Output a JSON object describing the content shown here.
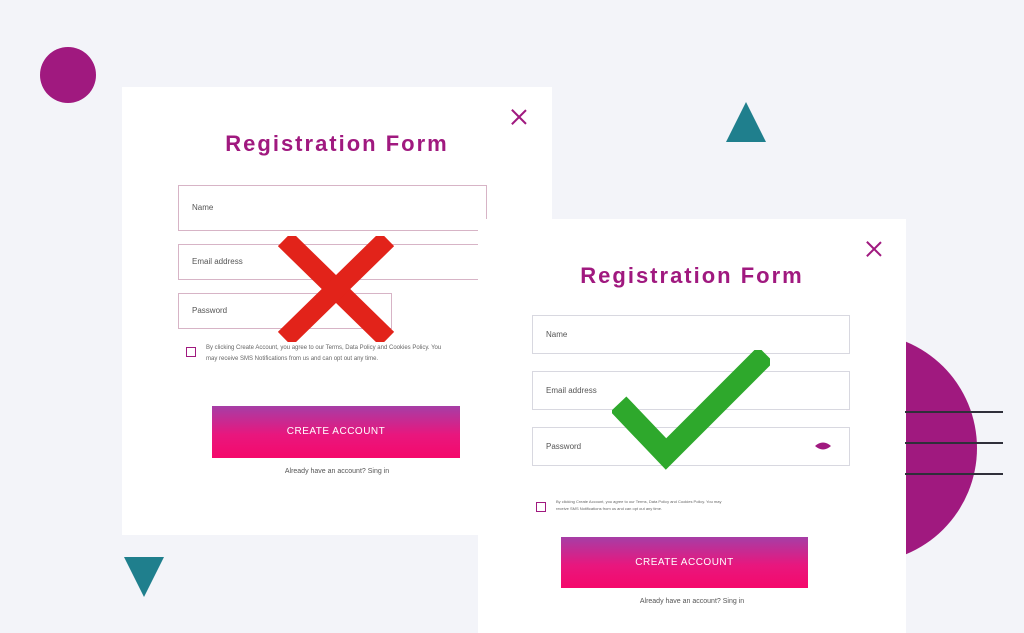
{
  "colors": {
    "brand_purple": "#a0197f",
    "accent_teal": "#1f7f8d",
    "button_pink": "#f5096b",
    "wrong_red": "#e2231a",
    "right_green": "#2ea82c"
  },
  "bad_form": {
    "title": "Registration Form",
    "name_placeholder": "Name",
    "email_placeholder": "Email address",
    "password_placeholder": "Password",
    "terms_line1": "By clicking Create Account, you agree to our Terms, Data Policy and Cookies Policy. You",
    "terms_line2": "may receive SMS Notifications from us and can opt out any time.",
    "button_label": "CREATE ACCOUNT",
    "signin_text": "Already have an account? Sing in",
    "verdict_icon": "red-x-icon"
  },
  "good_form": {
    "title": "Registration Form",
    "name_placeholder": "Name",
    "email_placeholder": "Email address",
    "password_placeholder": "Password",
    "terms_line1": "By clicking Create Account, you agree to our Terms, Data Policy and Cookies Policy. You may",
    "terms_line2": "receive SMS Notifications from us and can opt out any time.",
    "button_label": "CREATE ACCOUNT",
    "signin_text": "Already have an account? Sing in",
    "verdict_icon": "green-check-icon",
    "password_icon": "eye-icon"
  }
}
